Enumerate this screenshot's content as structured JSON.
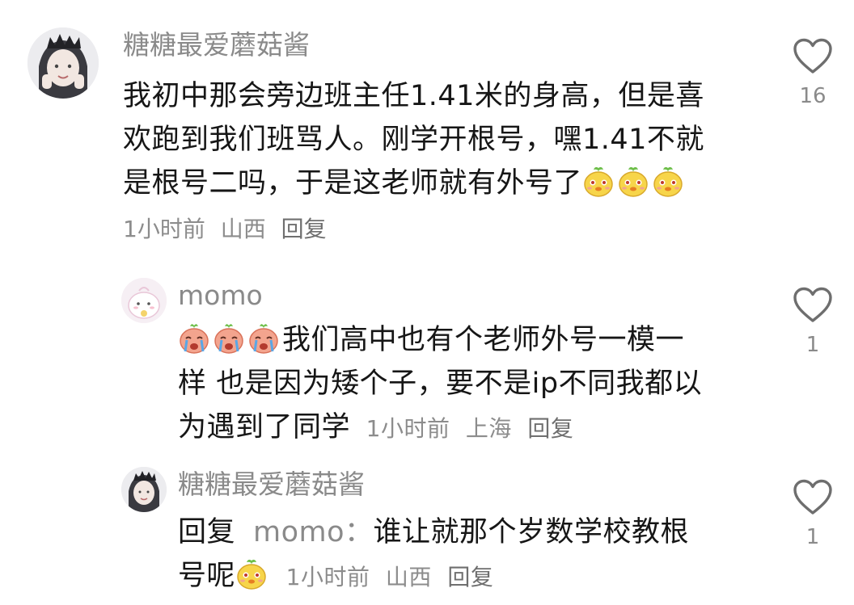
{
  "comments": [
    {
      "username": "糖糖最爱蘑菇酱",
      "line1": "我初中那会旁边班主任1.41米的身高，但是喜",
      "line2": "欢跑到我们班骂人。刚学开根号，嘿1.41不就",
      "line3": "是根号二吗，于是这老师就有外号了",
      "emoji_icon": "cute-dog-emoji",
      "emoji_count": 3,
      "time": "1小时前",
      "location": "山西",
      "reply_label": "回复",
      "like_count": "16"
    },
    {
      "username": "momo",
      "line1": "我们高中也有个老师外号一模一",
      "line2": "样 也是因为矮个子，要不是ip不同我都以",
      "line3": "为遇到了同学",
      "emoji_icon": "crying-face-emoji",
      "emoji_count": 3,
      "time": "1小时前",
      "location": "上海",
      "reply_label": "回复",
      "like_count": "1"
    },
    {
      "username": "糖糖最爱蘑菇酱",
      "reply_prefix": "回复",
      "reply_to": "momo：",
      "line1": "谁让就那个岁数学校教根",
      "line2": "号呢",
      "emoji_icon": "cute-dog-emoji",
      "emoji_count": 1,
      "time": "1小时前",
      "location": "山西",
      "reply_label": "回复",
      "like_count": "1"
    }
  ],
  "icons": {
    "like": "heart-outline-icon"
  },
  "colors": {
    "text": "#161616",
    "muted": "#8a8a8a",
    "emoji_yellow": "#f7d54a",
    "emoji_pink": "#f3a48e"
  }
}
